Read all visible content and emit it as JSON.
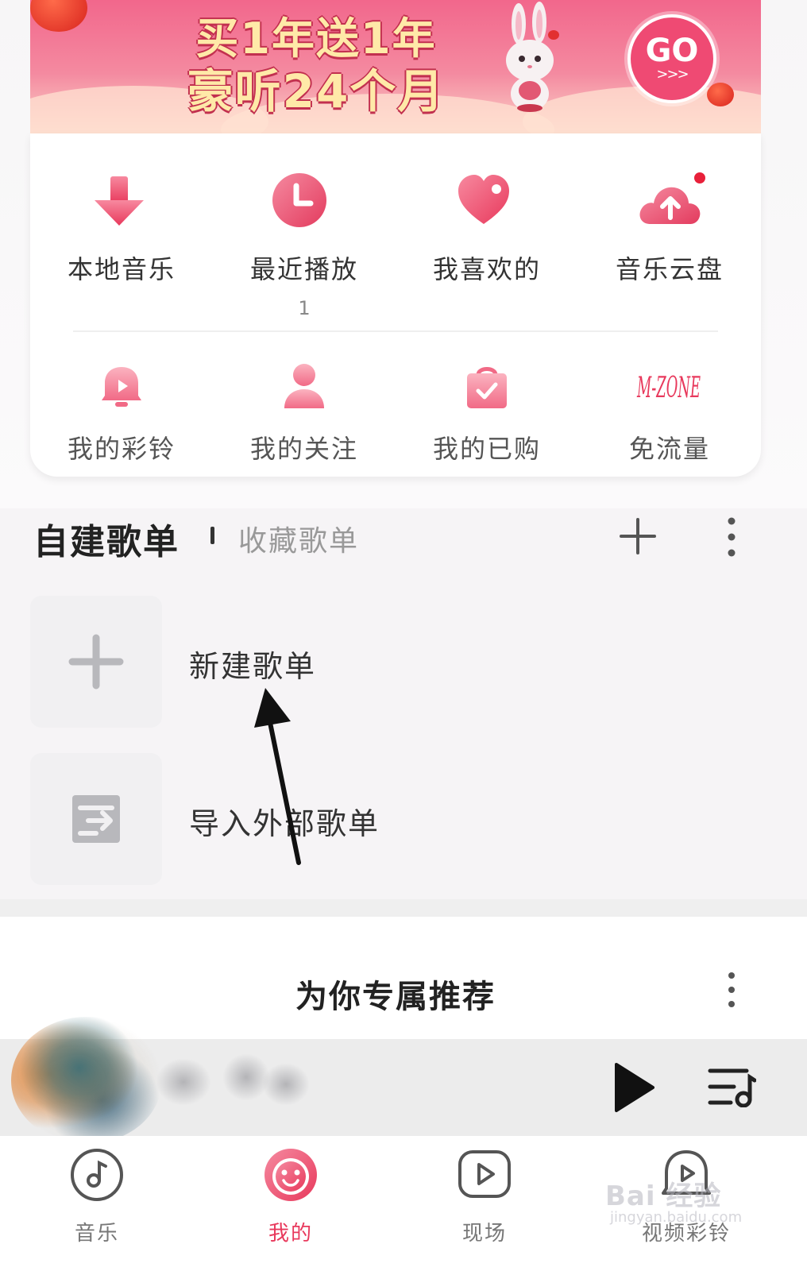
{
  "banner": {
    "line1": "买1年送1年",
    "line2": "豪听24个月",
    "go_label": "GO",
    "go_arrows": ">>>"
  },
  "quick_grid": {
    "row1": [
      {
        "label": "本地音乐",
        "icon": "download-arrow-icon",
        "sub": ""
      },
      {
        "label": "最近播放",
        "icon": "clock-icon",
        "sub": "1"
      },
      {
        "label": "我喜欢的",
        "icon": "heart-icon",
        "sub": ""
      },
      {
        "label": "音乐云盘",
        "icon": "cloud-upload-icon",
        "sub": ""
      }
    ],
    "row2": [
      {
        "label": "我的彩铃",
        "icon": "bell-icon"
      },
      {
        "label": "我的关注",
        "icon": "person-icon"
      },
      {
        "label": "我的已购",
        "icon": "shopping-bag-icon"
      },
      {
        "label": "免流量",
        "icon": "mzone-logo",
        "logo_text": "M-ZONE"
      }
    ]
  },
  "playlist_tabs": {
    "active": "自建歌单",
    "inactive": "收藏歌单"
  },
  "playlist_actions": [
    {
      "label": "新建歌单",
      "icon": "plus-icon"
    },
    {
      "label": "导入外部歌单",
      "icon": "import-playlist-icon"
    }
  ],
  "recommend": {
    "title": "为你专属推荐"
  },
  "bottom_nav": [
    {
      "label": "音乐",
      "icon": "music-note-icon",
      "active": false
    },
    {
      "label": "我的",
      "icon": "smiley-face-icon",
      "active": true
    },
    {
      "label": "现场",
      "icon": "video-play-icon",
      "active": false
    },
    {
      "label": "视频彩铃",
      "icon": "video-ringtone-icon",
      "active": false
    }
  ],
  "watermark": {
    "text": "Bai 经验",
    "sub": "jingyan.baidu.com"
  },
  "colors": {
    "accent": "#e8395c",
    "banner_pink": "#f2678c",
    "icon_pink": "#f05a78"
  }
}
